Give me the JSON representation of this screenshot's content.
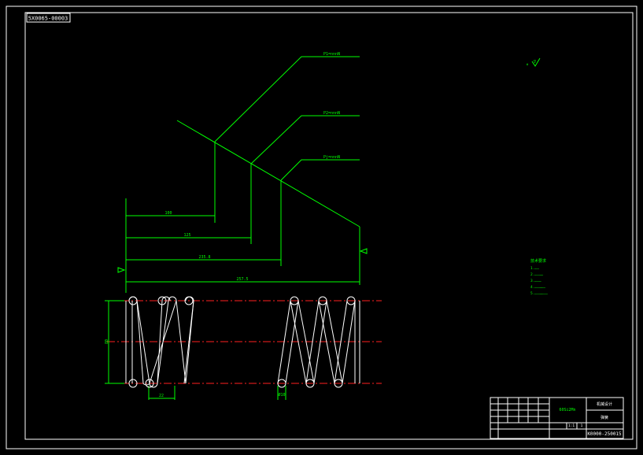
{
  "drawing_code_top": "5X0065-00003",
  "drawing_code_bottom": "K0000-250015",
  "colors": {
    "background": "#000000",
    "outline": "#ffffff",
    "dimension": "#00ff00",
    "centerline": "#ff2020"
  },
  "roughness_note": "∇",
  "load_labels": {
    "p1": "P1=nnnN",
    "p2": "P2=nnnN",
    "p3": "Pj=nnnN"
  },
  "dimensions": {
    "h1": "100",
    "h2": "125",
    "h3": "235.8",
    "h_total": "257.5",
    "diameter": "80",
    "pitch": "22",
    "wire": "Ø10"
  },
  "tech_requirements": {
    "title": "技术要求",
    "items": [
      "1.……",
      "2.…………",
      "3.………",
      "4.……………",
      "5.………………"
    ]
  },
  "title_block": {
    "part_name": "弹簧",
    "material": "60Si2Mn",
    "company": "机械设计",
    "scale": "1:1",
    "sheet": "1"
  }
}
